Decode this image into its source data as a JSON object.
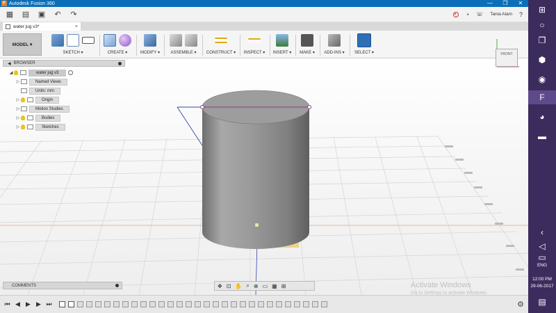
{
  "window": {
    "title": "Autodesk Fusion 360",
    "minimize_glyph": "—",
    "maximize_glyph": "❐",
    "close_glyph": "✕"
  },
  "quick_access": {
    "user": "Tania Alam"
  },
  "document_tab": {
    "name": "water jug v3*",
    "close_glyph": "×"
  },
  "ribbon": {
    "workspace": "MODEL ▾",
    "groups": [
      {
        "label": "SKETCH ▾"
      },
      {
        "label": "CREATE ▾"
      },
      {
        "label": "MODIFY ▾"
      },
      {
        "label": "ASSEMBLE ▾"
      },
      {
        "label": "CONSTRUCT ▾"
      },
      {
        "label": "INSPECT ▾"
      },
      {
        "label": "INSERT ▾"
      },
      {
        "label": "MAKE ▾"
      },
      {
        "label": "ADD-INS ▾"
      },
      {
        "label": "SELECT ▾"
      }
    ]
  },
  "browser": {
    "title": "BROWSER",
    "root": "water jug v3",
    "items": [
      {
        "label": "Named Views"
      },
      {
        "label": "Units: mm"
      },
      {
        "label": "Origin"
      },
      {
        "label": "Motion Studies"
      },
      {
        "label": "Bodies"
      },
      {
        "label": "Sketches"
      }
    ]
  },
  "viewcube": {
    "face": "FRONT"
  },
  "comments": {
    "title": "COMMENTS"
  },
  "watermark": {
    "line1": "Activate Windows",
    "line2": "Go to Settings to activate Windows."
  },
  "taskbar": {
    "lang": "ENG",
    "time": "12:00 PM",
    "date": "29-06-2017"
  },
  "colors": {
    "title_bar": "#0a6fb8",
    "win_sidebar": "#3c2c5e",
    "body": "#9a9a9a",
    "sketch_line": "#8a3a8a",
    "construction": "#3344aa"
  }
}
